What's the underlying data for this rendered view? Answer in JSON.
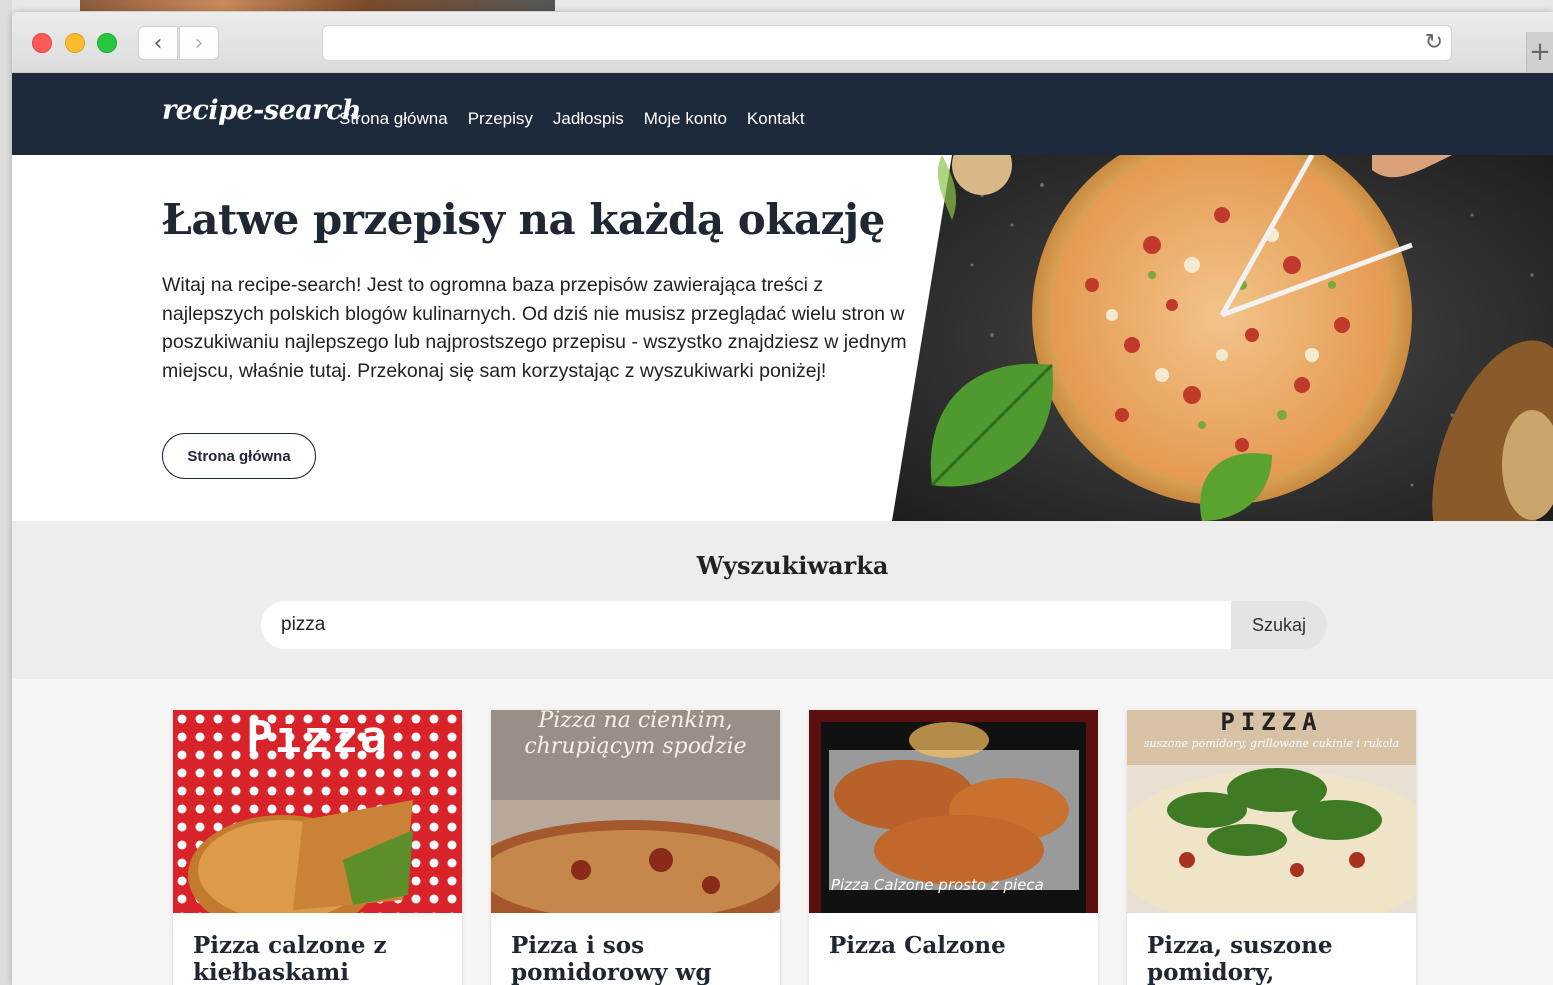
{
  "browser": {
    "url": "",
    "back_icon": "‹",
    "forward_icon": "›",
    "reload_icon": "↻",
    "new_tab_icon": "+"
  },
  "site": {
    "logo": "recipe-search",
    "nav": [
      "Strona główna",
      "Przepisy",
      "Jadłospis",
      "Moje konto",
      "Kontakt"
    ]
  },
  "hero": {
    "title": "Łatwe przepisy na każdą okazję",
    "text": "Witaj na recipe-search! Jest to ogromna baza przepisów zawierająca treści z najlepszych polskich blogów kulinarnych. Od dziś nie musisz przeglądać wielu stron w poszukiwaniu najlepszego lub najprostszego przepisu - wszystko znajdziesz w jednym miejscu, właśnie tutaj. Przekonaj się sam korzystając z wyszukiwarki poniżej!",
    "button": "Strona główna"
  },
  "search": {
    "title": "Wyszukiwarka",
    "value": "pizza",
    "button": "Szukaj"
  },
  "cards": [
    {
      "title": "Pizza calzone z kiełbaskami",
      "image_text": "Pizza"
    },
    {
      "title": "Pizza i sos pomidorowy wg",
      "image_text_1": "Pizza na cienkim,",
      "image_text_2": "chrupiącym spodzie"
    },
    {
      "title": "Pizza Calzone",
      "image_text": "Pizza Calzone prosto z pieca"
    },
    {
      "title": "Pizza, suszone pomidory,",
      "image_text_1": "PIZZA",
      "image_text_2": "suszone pomidory, grillowane cukinie i rukola"
    }
  ],
  "colors": {
    "navbar": "#1c2a3c",
    "title_text": "#1f2733",
    "search_bg": "#ededed"
  }
}
